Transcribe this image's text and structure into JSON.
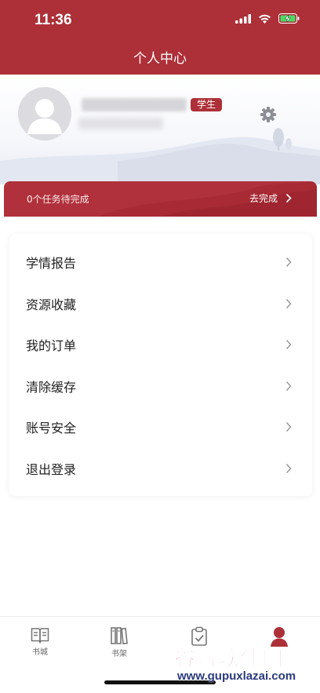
{
  "status_bar": {
    "time": "11:36"
  },
  "header": {
    "title": "个人中心"
  },
  "profile": {
    "role_badge": "学生"
  },
  "task_banner": {
    "text": "0个任务待完成",
    "action": "去完成"
  },
  "menu": {
    "items": [
      {
        "label": "学情报告"
      },
      {
        "label": "资源收藏"
      },
      {
        "label": "我的订单"
      },
      {
        "label": "清除缓存"
      },
      {
        "label": "账号安全"
      },
      {
        "label": "退出登录"
      }
    ]
  },
  "tabs": [
    {
      "label": "书城",
      "icon": "book-open-icon"
    },
    {
      "label": "书架",
      "icon": "bookshelf-icon"
    },
    {
      "label": "",
      "icon": "clipboard-check-icon"
    },
    {
      "label": "",
      "icon": "person-icon",
      "active": true
    }
  ],
  "watermark": {
    "title": "谷普软件园",
    "url": "www.gupuxlazai.com"
  },
  "colors": {
    "brand": "#ad3038",
    "background": "#ffffff",
    "text": "#222222"
  }
}
